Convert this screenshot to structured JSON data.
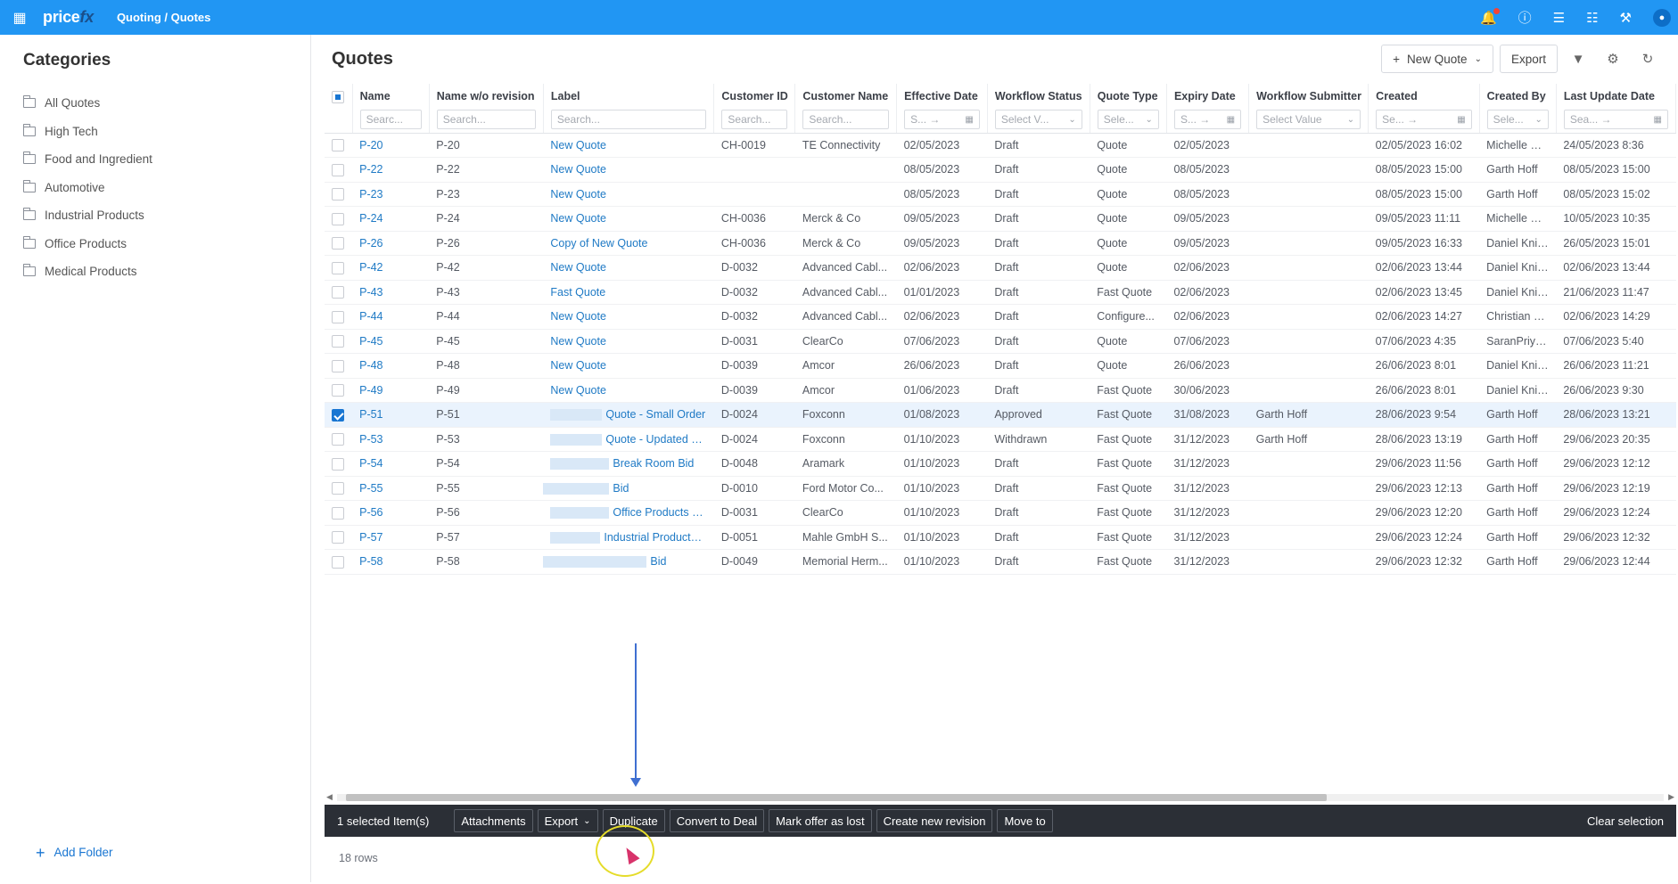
{
  "topbar": {
    "logo": "price",
    "logo_fx": "fx",
    "breadcrumb": "Quoting / Quotes",
    "icons": [
      "bell-icon",
      "help-icon",
      "sliders-icon",
      "database-icon",
      "tools-icon",
      "user-avatar"
    ]
  },
  "sidebar": {
    "title": "Categories",
    "items": [
      {
        "label": "All Quotes"
      },
      {
        "label": "High Tech"
      },
      {
        "label": "Food and Ingredient"
      },
      {
        "label": "Automotive"
      },
      {
        "label": "Industrial Products"
      },
      {
        "label": "Office Products"
      },
      {
        "label": "Medical Products"
      }
    ],
    "add_folder": "Add Folder"
  },
  "main": {
    "title": "Quotes",
    "new_quote": "New Quote",
    "export": "Export"
  },
  "grid": {
    "columns": [
      {
        "label": "Name",
        "filter": "Searc..."
      },
      {
        "label": "Name w/o revision",
        "filter": "Search..."
      },
      {
        "label": "Label",
        "filter": "Search..."
      },
      {
        "label": "Customer ID",
        "filter": "Search..."
      },
      {
        "label": "Customer Name",
        "filter": "Search..."
      },
      {
        "label": "Effective Date",
        "filter": "S... →"
      },
      {
        "label": "Workflow Status",
        "filter": "Select V..."
      },
      {
        "label": "Quote Type",
        "filter": "Sele..."
      },
      {
        "label": "Expiry Date",
        "filter": "S... →"
      },
      {
        "label": "Workflow Submitter",
        "filter": "Select Value"
      },
      {
        "label": "Created",
        "filter": "Se... →"
      },
      {
        "label": "Created By",
        "filter": "Sele..."
      },
      {
        "label": "Last Update Date",
        "filter": "Sea... →"
      }
    ],
    "rows": [
      {
        "name": "P-20",
        "nwr": "P-20",
        "label": "New Quote",
        "cid": "CH-0019",
        "cname": "TE Connectivity",
        "eff": "02/05/2023",
        "status": "Draft",
        "type": "Quote",
        "exp": "02/05/2023",
        "submitter": "",
        "created": "02/05/2023 16:02",
        "by": "Michelle Duffy",
        "updated": "24/05/2023 8:36",
        "selected": false,
        "redact": 0
      },
      {
        "name": "P-22",
        "nwr": "P-22",
        "label": "New Quote",
        "cid": "",
        "cname": "",
        "eff": "08/05/2023",
        "status": "Draft",
        "type": "Quote",
        "exp": "08/05/2023",
        "submitter": "",
        "created": "08/05/2023 15:00",
        "by": "Garth Hoff",
        "updated": "08/05/2023 15:00",
        "selected": false,
        "redact": 0
      },
      {
        "name": "P-23",
        "nwr": "P-23",
        "label": "New Quote",
        "cid": "",
        "cname": "",
        "eff": "08/05/2023",
        "status": "Draft",
        "type": "Quote",
        "exp": "08/05/2023",
        "submitter": "",
        "created": "08/05/2023 15:00",
        "by": "Garth Hoff",
        "updated": "08/05/2023 15:02",
        "selected": false,
        "redact": 0
      },
      {
        "name": "P-24",
        "nwr": "P-24",
        "label": "New Quote",
        "cid": "CH-0036",
        "cname": "Merck & Co",
        "eff": "09/05/2023",
        "status": "Draft",
        "type": "Quote",
        "exp": "09/05/2023",
        "submitter": "",
        "created": "09/05/2023 11:11",
        "by": "Michelle Duffy",
        "updated": "10/05/2023 10:35",
        "selected": false,
        "redact": 0
      },
      {
        "name": "P-26",
        "nwr": "P-26",
        "label": "Copy of New Quote",
        "cid": "CH-0036",
        "cname": "Merck & Co",
        "eff": "09/05/2023",
        "status": "Draft",
        "type": "Quote",
        "exp": "09/05/2023",
        "submitter": "",
        "created": "09/05/2023 16:33",
        "by": "Daniel Knittel",
        "updated": "26/05/2023 15:01",
        "selected": false,
        "redact": 0
      },
      {
        "name": "P-42",
        "nwr": "P-42",
        "label": "New Quote",
        "cid": "D-0032",
        "cname": "Advanced Cabl...",
        "eff": "02/06/2023",
        "status": "Draft",
        "type": "Quote",
        "exp": "02/06/2023",
        "submitter": "",
        "created": "02/06/2023 13:44",
        "by": "Daniel Knittel",
        "updated": "02/06/2023 13:44",
        "selected": false,
        "redact": 0
      },
      {
        "name": "P-43",
        "nwr": "P-43",
        "label": "Fast Quote",
        "cid": "D-0032",
        "cname": "Advanced Cabl...",
        "eff": "01/01/2023",
        "status": "Draft",
        "type": "Fast Quote",
        "exp": "02/06/2023",
        "submitter": "",
        "created": "02/06/2023 13:45",
        "by": "Daniel Knittel",
        "updated": "21/06/2023 11:47",
        "selected": false,
        "redact": 0
      },
      {
        "name": "P-44",
        "nwr": "P-44",
        "label": "New Quote",
        "cid": "D-0032",
        "cname": "Advanced Cabl...",
        "eff": "02/06/2023",
        "status": "Draft",
        "type": "Configure...",
        "exp": "02/06/2023",
        "submitter": "",
        "created": "02/06/2023 14:27",
        "by": "Christian Cres",
        "updated": "02/06/2023 14:29",
        "selected": false,
        "redact": 0
      },
      {
        "name": "P-45",
        "nwr": "P-45",
        "label": "New Quote",
        "cid": "D-0031",
        "cname": "ClearCo",
        "eff": "07/06/2023",
        "status": "Draft",
        "type": "Quote",
        "exp": "07/06/2023",
        "submitter": "",
        "created": "07/06/2023 4:35",
        "by": "SaranPriya Mu",
        "updated": "07/06/2023 5:40",
        "selected": false,
        "redact": 0
      },
      {
        "name": "P-48",
        "nwr": "P-48",
        "label": "New Quote",
        "cid": "D-0039",
        "cname": "Amcor",
        "eff": "26/06/2023",
        "status": "Draft",
        "type": "Quote",
        "exp": "26/06/2023",
        "submitter": "",
        "created": "26/06/2023 8:01",
        "by": "Daniel Knittel",
        "updated": "26/06/2023 11:21",
        "selected": false,
        "redact": 0
      },
      {
        "name": "P-49",
        "nwr": "P-49",
        "label": "New Quote",
        "cid": "D-0039",
        "cname": "Amcor",
        "eff": "01/06/2023",
        "status": "Draft",
        "type": "Fast Quote",
        "exp": "30/06/2023",
        "submitter": "",
        "created": "26/06/2023 8:01",
        "by": "Daniel Knittel",
        "updated": "26/06/2023 9:30",
        "selected": false,
        "redact": 0
      },
      {
        "name": "P-51",
        "nwr": "P-51",
        "label": "Quote - Small Order",
        "cid": "D-0024",
        "cname": "Foxconn",
        "eff": "01/08/2023",
        "status": "Approved",
        "type": "Fast Quote",
        "exp": "31/08/2023",
        "submitter": "Garth Hoff",
        "created": "28/06/2023 9:54",
        "by": "Garth Hoff",
        "updated": "28/06/2023 13:21",
        "selected": true,
        "redact": 58
      },
      {
        "name": "P-53",
        "nwr": "P-53",
        "label": "Quote - Updated Bid",
        "cid": "D-0024",
        "cname": "Foxconn",
        "eff": "01/10/2023",
        "status": "Withdrawn",
        "type": "Fast Quote",
        "exp": "31/12/2023",
        "submitter": "Garth Hoff",
        "created": "28/06/2023 13:19",
        "by": "Garth Hoff",
        "updated": "29/06/2023 20:35",
        "selected": false,
        "redact": 58
      },
      {
        "name": "P-54",
        "nwr": "P-54",
        "label": "Break Room Bid",
        "cid": "D-0048",
        "cname": "Aramark",
        "eff": "01/10/2023",
        "status": "Draft",
        "type": "Fast Quote",
        "exp": "31/12/2023",
        "submitter": "",
        "created": "29/06/2023 11:56",
        "by": "Garth Hoff",
        "updated": "29/06/2023 12:12",
        "selected": false,
        "redact": 66
      },
      {
        "name": "P-55",
        "nwr": "P-55",
        "label": "Bid",
        "cid": "D-0010",
        "cname": "Ford Motor Co...",
        "eff": "01/10/2023",
        "status": "Draft",
        "type": "Fast Quote",
        "exp": "31/12/2023",
        "submitter": "",
        "created": "29/06/2023 12:13",
        "by": "Garth Hoff",
        "updated": "29/06/2023 12:19",
        "selected": false,
        "redact": 74
      },
      {
        "name": "P-56",
        "nwr": "P-56",
        "label": "Office Products Bid",
        "cid": "D-0031",
        "cname": "ClearCo",
        "eff": "01/10/2023",
        "status": "Draft",
        "type": "Fast Quote",
        "exp": "31/12/2023",
        "submitter": "",
        "created": "29/06/2023 12:20",
        "by": "Garth Hoff",
        "updated": "29/06/2023 12:24",
        "selected": false,
        "redact": 66
      },
      {
        "name": "P-57",
        "nwr": "P-57",
        "label": "Industrial Products Bid",
        "cid": "D-0051",
        "cname": "Mahle GmbH S...",
        "eff": "01/10/2023",
        "status": "Draft",
        "type": "Fast Quote",
        "exp": "31/12/2023",
        "submitter": "",
        "created": "29/06/2023 12:24",
        "by": "Garth Hoff",
        "updated": "29/06/2023 12:32",
        "selected": false,
        "redact": 56
      },
      {
        "name": "P-58",
        "nwr": "P-58",
        "label": "Bid",
        "cid": "D-0049",
        "cname": "Memorial Herm...",
        "eff": "01/10/2023",
        "status": "Draft",
        "type": "Fast Quote",
        "exp": "31/12/2023",
        "submitter": "",
        "created": "29/06/2023 12:32",
        "by": "Garth Hoff",
        "updated": "29/06/2023 12:44",
        "selected": false,
        "redact": 116
      }
    ]
  },
  "selection_bar": {
    "count": "1 selected Item(s)",
    "buttons": [
      "Attachments",
      "Export",
      "Duplicate",
      "Convert to Deal",
      "Mark offer as lost",
      "Create new revision",
      "Move to"
    ],
    "clear": "Clear selection"
  },
  "footer": {
    "rows": "18 rows"
  }
}
